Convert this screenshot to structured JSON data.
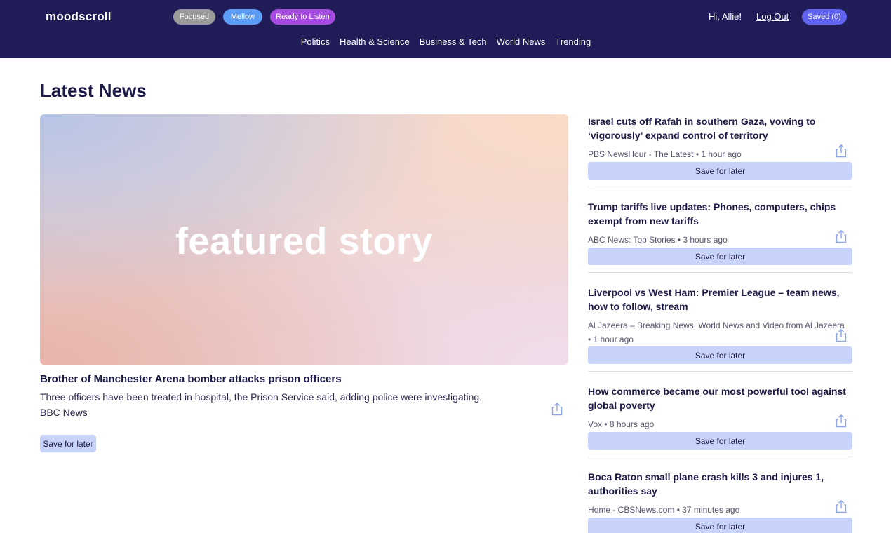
{
  "header": {
    "logo": "moodscroll",
    "moods": [
      "Focused",
      "Mellow",
      "Ready to Listen"
    ],
    "greeting": "Hi, Allie!",
    "logout_label": "Log Out",
    "saved_label": "Saved (0)",
    "nav": [
      "Politics",
      "Health & Science",
      "Business & Tech",
      "World News",
      "Trending"
    ]
  },
  "main": {
    "title": "Latest News",
    "featured": {
      "image_text": "featured story",
      "headline": "Brother of Manchester Arena bomber attacks prison officers",
      "summary": "Three officers have been treated in hospital, the Prison Service said, adding police were investigating.",
      "source": "BBC News",
      "save_label": "Save for later"
    }
  },
  "sidebar": {
    "stories": [
      {
        "headline": "Israel cuts off Rafah in southern Gaza, vowing to ‘vigorously’ expand control of territory",
        "meta": "PBS NewsHour - The Latest • 1 hour ago",
        "save_label": "Save for later"
      },
      {
        "headline": "Trump tariffs live updates: Phones, computers, chips exempt from new tariffs",
        "meta": "ABC News: Top Stories • 3 hours ago",
        "save_label": "Save for later"
      },
      {
        "headline": "Liverpool vs West Ham: Premier League – team news, how to follow, stream",
        "meta": "Al Jazeera – Breaking News, World News and Video from Al Jazeera • 1 hour ago",
        "save_label": "Save for later"
      },
      {
        "headline": "How commerce became our most powerful tool against global poverty",
        "meta": "Vox • 8 hours ago",
        "save_label": "Save for later"
      },
      {
        "headline": "Boca Raton small plane crash kills 3 and injures 1, authorities say",
        "meta": "Home - CBSNews.com • 37 minutes ago",
        "save_label": "Save for later"
      }
    ]
  },
  "colors": {
    "header_bg": "#201c57",
    "focused": "#9a9a9a",
    "mellow": "#5b9cf6",
    "ready_to_listen": "#a54bdf",
    "saved": "#6062f0",
    "save_button": "#c8d3fb"
  },
  "icons": {
    "share": "share-icon"
  }
}
